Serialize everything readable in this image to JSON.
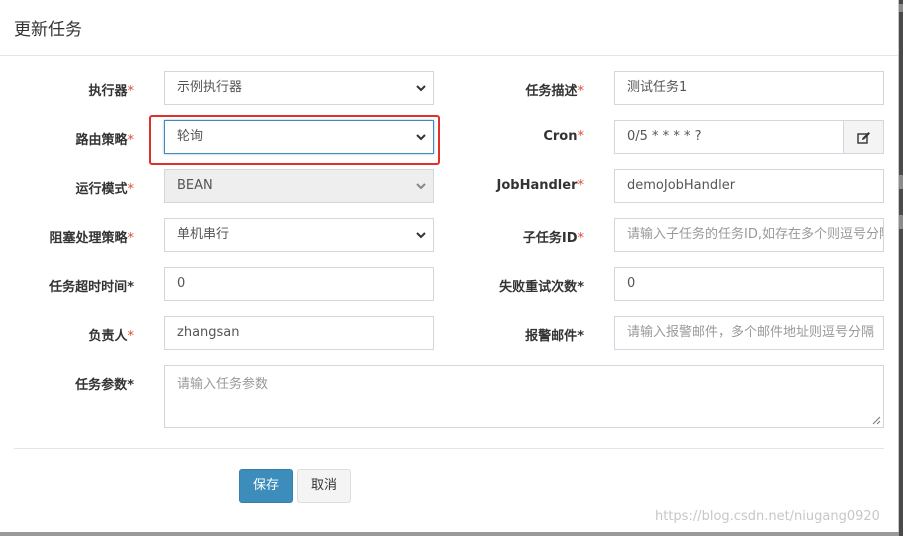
{
  "dialog": {
    "title": "更新任务"
  },
  "required_mark": "*",
  "left": {
    "executor": {
      "label": "执行器",
      "value": "示例执行器"
    },
    "route_strategy": {
      "label": "路由策略",
      "value": "轮询"
    },
    "run_mode": {
      "label": "运行模式",
      "value": "BEAN"
    },
    "block_strategy": {
      "label": "阻塞处理策略",
      "value": "单机串行"
    },
    "timeout": {
      "label": "任务超时时间",
      "value": "0"
    },
    "owner": {
      "label": "负责人",
      "value": "zhangsan"
    },
    "params": {
      "label": "任务参数",
      "placeholder": "请输入任务参数"
    }
  },
  "right": {
    "job_desc": {
      "label": "任务描述",
      "value": "测试任务1"
    },
    "cron": {
      "label": "Cron",
      "value": "0/5 * * * * ?",
      "icon": "edit-icon"
    },
    "job_handler": {
      "label": "JobHandler",
      "value": "demoJobHandler"
    },
    "child_job": {
      "label": "子任务ID",
      "placeholder": "请输入子任务的任务ID,如存在多个则逗号分隔"
    },
    "retry": {
      "label": "失败重试次数",
      "value": "0"
    },
    "alarm_email": {
      "label": "报警邮件",
      "placeholder": "请输入报警邮件，多个邮件地址则逗号分隔"
    }
  },
  "buttons": {
    "save": "保存",
    "cancel": "取消"
  },
  "watermark": "https://blog.csdn.net/niugang0920",
  "colors": {
    "primary": "#3c8dbc",
    "required": "#dd4b39",
    "highlight_box": "#e0302a"
  }
}
